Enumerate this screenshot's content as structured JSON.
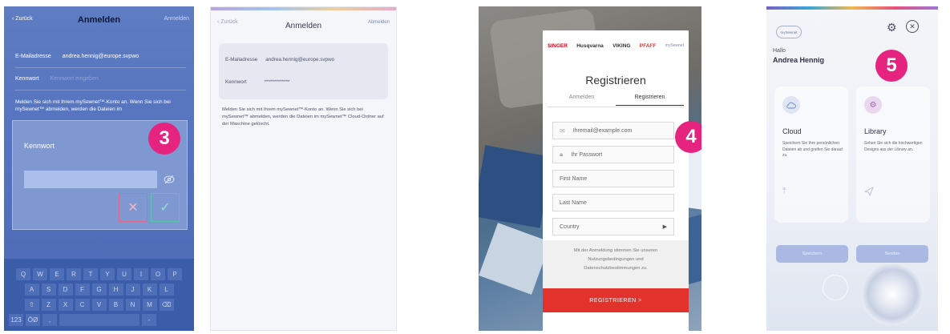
{
  "panel1": {
    "nav": {
      "back": "Zurück",
      "title": "Anmelden",
      "action": "Anmelden"
    },
    "email_label": "E-Mailadresse",
    "email_value": "andrea.hennig@europe.svpwo",
    "password_label": "Kennwort",
    "password_placeholder": "Kennwort eingeben",
    "note": "Melden Sie sich mit Ihrem mySewnet™-Konto an. Wenn Sie sich bei mySewnet™ abmelden, werden die Dateien im",
    "dialog": {
      "title": "Kennwort",
      "eye_icon": "eye-off-icon",
      "cancel": "✕",
      "confirm": "✓"
    },
    "badge": "3",
    "keyboard": {
      "row1": [
        "Q",
        "W",
        "E",
        "R",
        "T",
        "Y",
        "U",
        "I",
        "O",
        "P"
      ],
      "row2": [
        "A",
        "S",
        "D",
        "F",
        "G",
        "H",
        "J",
        "K",
        "L"
      ],
      "row3": [
        "⇧",
        "Z",
        "X",
        "C",
        "V",
        "B",
        "N",
        "M",
        "⌫"
      ],
      "row4": [
        "123",
        "ÖØ",
        ",",
        "",
        "-"
      ]
    },
    "colors": {
      "bg": "#5674bf",
      "dialog": "#7f98d2"
    }
  },
  "panel2": {
    "nav": {
      "back": "Zurück",
      "title": "Anmelden",
      "action": "Abmelden"
    },
    "email_label": "E-Mailadresse",
    "email_value": "andrea.hennig@europe.svpwo",
    "password_label": "Kennwort",
    "password_value": "*************",
    "note": "Melden Sie sich mit Ihrem mySewnet™-Konto an. Wenn Sie sich bei mySewnet™ abmelden, werden die Dateien im mySewnet™ Cloud-Ordner auf der Maschine gelöscht."
  },
  "panel3": {
    "brands": [
      "SINGER",
      "Husqvarna",
      "VIKING",
      "PFAFF",
      "mySewnet"
    ],
    "title": "Registrieren",
    "tabs": [
      "Anmelden",
      "Registrieren"
    ],
    "active_tab": "Registrieren",
    "fields": {
      "email": "Ihremail@example.com",
      "password": "Ihr Passwort",
      "first_name": "First Name",
      "last_name": "Last Name",
      "country": "Country"
    },
    "terms_line1": "Mit der Anmeldung stimmen Sie unseren",
    "terms_line2": "Nutzungsbedingungen und",
    "terms_line3": "Datenschutzbestimmungen zu.",
    "button": "REGISTRIEREN >",
    "badge": "4",
    "colors": {
      "button": "#e2322b"
    }
  },
  "panel4": {
    "logo": "mySewnet",
    "hello": "Hallo",
    "name": "Andrea Hennig",
    "badge": "5",
    "cards": [
      {
        "icon": "cloud-icon",
        "title": "Cloud",
        "desc": "Speichern Sie Ihre persönlichen Dateien ab und greifen Sie darauf zu.",
        "button": "Speichern",
        "action_icon": "upload-icon"
      },
      {
        "icon": "library-icon",
        "title": "Library",
        "desc": "Sehen Sie sich die hochwertigen Designs aus der Library an.",
        "button": "Senden",
        "action_icon": "send-icon"
      }
    ],
    "colors": {
      "badge": "#e6237e",
      "button": "#aab9e3"
    }
  }
}
